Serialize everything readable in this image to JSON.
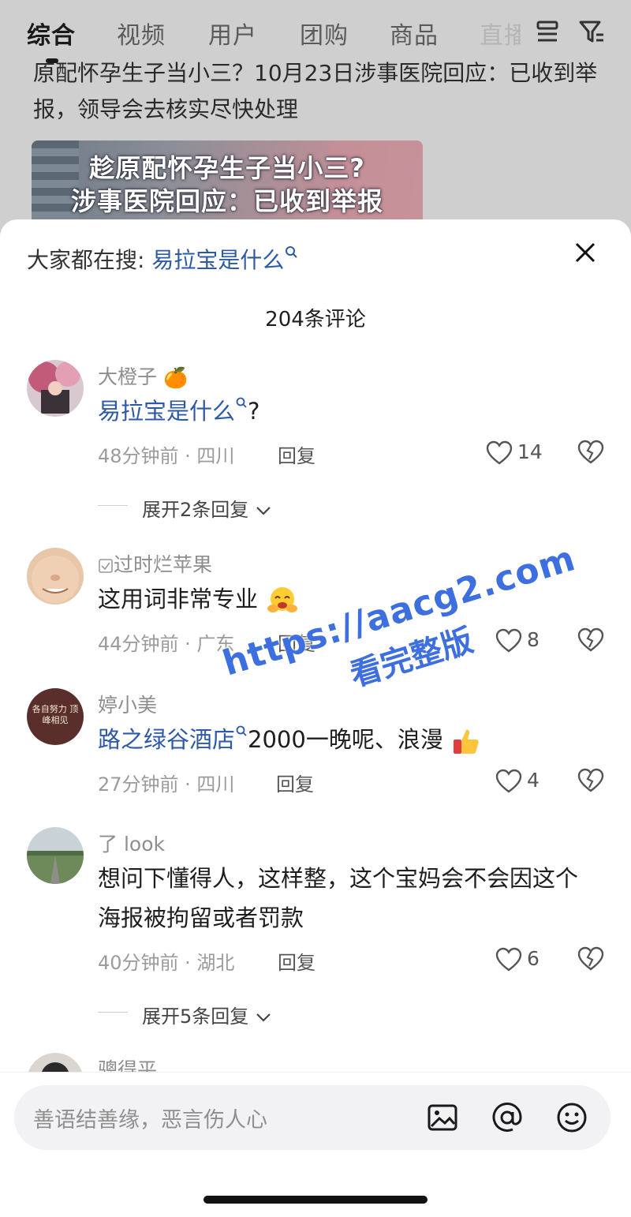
{
  "tabs": [
    "综合",
    "视频",
    "用户",
    "团购",
    "商品",
    "直播"
  ],
  "tab_icons": [
    "list-icon",
    "filter-icon"
  ],
  "headline": "原配怀孕生子当小三？10月23日涉事医院回应：已收到举报，领导会去核实尽快处理",
  "thumbnail": {
    "line1": "趁原配怀孕生子当小三?",
    "line2": "涉事医院回应：已收到举报"
  },
  "sheet": {
    "search_label": "大家都在搜:",
    "search_keyword": "易拉宝是什么",
    "comment_count": "204条评论"
  },
  "comments": [
    {
      "user": "大橙子",
      "user_emoji": "🍊",
      "keyword": "易拉宝是什么",
      "text": "?",
      "time": "48分钟前 · 四川",
      "reply": "回复",
      "likes": "14",
      "expand": "展开2条回复"
    },
    {
      "user": "过时烂苹果",
      "text": "这用词非常专业",
      "time": "44分钟前 · 广东",
      "reply": "回复",
      "likes": "8"
    },
    {
      "user": "婷小美",
      "keyword": "路之绿谷酒店",
      "text": "2000一晚呢、浪漫",
      "time": "27分钟前 · 四川",
      "reply": "回复",
      "likes": "4",
      "avatar_text": "各自努力 顶峰相见"
    },
    {
      "user": "了 look",
      "text": "想问下懂得人，这样整，这个宝妈会不会因这个海报被拘留或者罚款",
      "time": "40分钟前 · 湖北",
      "reply": "回复",
      "likes": "6",
      "expand": "展开5条回复"
    },
    {
      "user": "骢得平"
    }
  ],
  "input": {
    "placeholder": "善语结善缘，恶言伤人心",
    "icons": [
      "image-icon",
      "at-icon",
      "emoji-icon"
    ]
  },
  "watermark": {
    "line1": "https://aacg2.com",
    "line2": "看完整版"
  },
  "colors": {
    "keyword_blue": "#2d5aa7",
    "watermark_blue": "#3d6fe0"
  }
}
